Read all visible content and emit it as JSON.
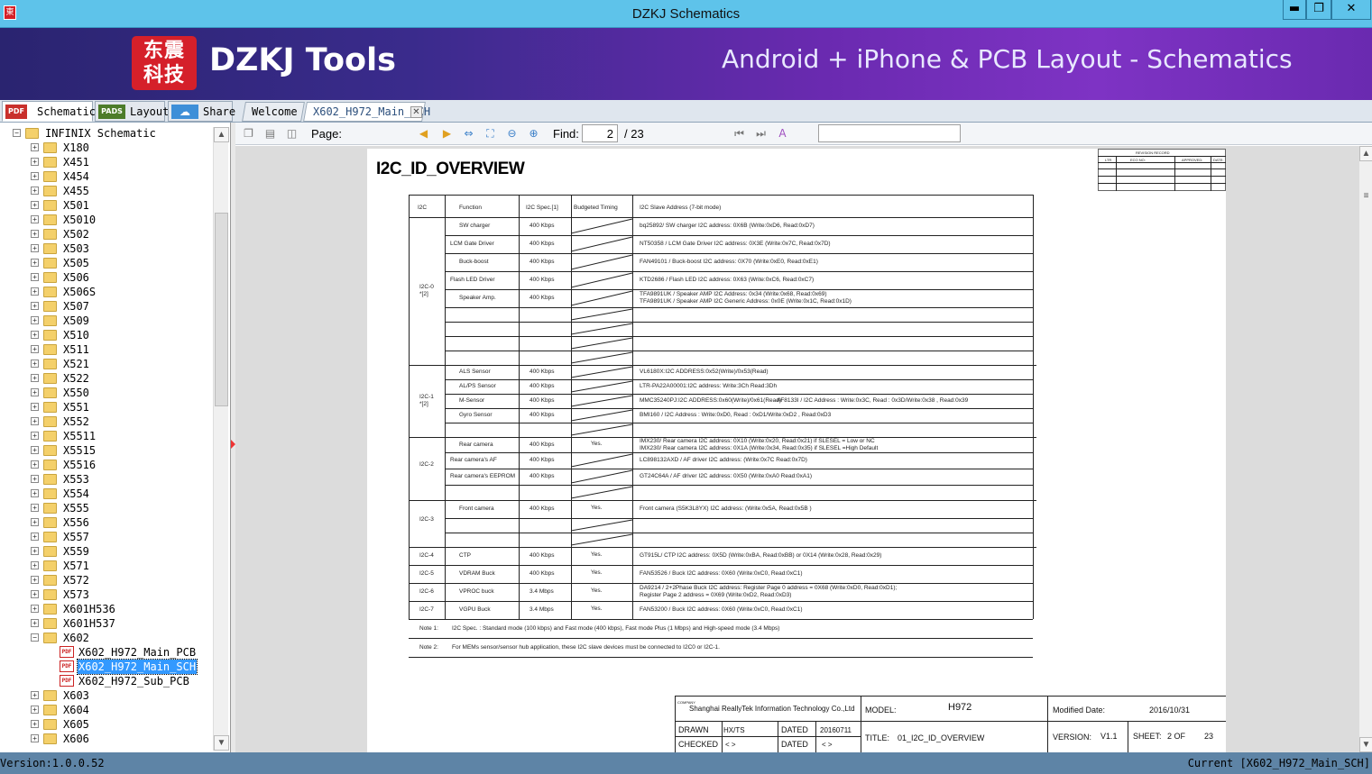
{
  "window": {
    "title": "DZKJ Schematics",
    "icon_label": "東",
    "min": "▬",
    "max": "❐",
    "close": "✕"
  },
  "banner": {
    "logo": "东震\n科技",
    "brand": "DZKJ Tools",
    "tagline": "Android + iPhone & PCB Layout - Schematics"
  },
  "left_tabs": [
    {
      "icon": "PDF",
      "label": "Schematic",
      "active": true,
      "color": "#c9302c"
    },
    {
      "icon": "PADS",
      "label": "Layout",
      "active": false,
      "color": "#4d7c2a"
    },
    {
      "icon": "☁",
      "label": "Share",
      "active": false,
      "color": "#3e8fd8"
    }
  ],
  "doc_tabs": [
    {
      "label": "Welcome",
      "active": false
    },
    {
      "label": "X602_H972_Main_SCH",
      "active": true
    }
  ],
  "tab_close": "✕",
  "tree": {
    "root": "INFINIX Schematic",
    "folders": [
      "X180",
      "X451",
      "X454",
      "X455",
      "X501",
      "X5010",
      "X502",
      "X503",
      "X505",
      "X506",
      "X506S",
      "X507",
      "X509",
      "X510",
      "X511",
      "X521",
      "X522",
      "X550",
      "X551",
      "X552",
      "X5511",
      "X5515",
      "X5516",
      "X553",
      "X554",
      "X555",
      "X556",
      "X557",
      "X559",
      "X571",
      "X572",
      "X573",
      "X601H536",
      "X601H537",
      "X602"
    ],
    "x602_children": [
      "X602_H972_Main_PCB",
      "X602_H972_Main_SCH",
      "X602_H972_Sub_PCB"
    ],
    "selected": "X602_H972_Main_SCH",
    "after": [
      "X603",
      "X604",
      "X605",
      "X606"
    ],
    "pdf_icon": "PDF"
  },
  "toolbar": {
    "page_label": "Page:",
    "page_value": "2",
    "page_total": "/ 23",
    "find_label": "Find:",
    "find_value": ""
  },
  "sheet": {
    "title": "I2C_ID_OVERVIEW",
    "revision_header": "REVISION RECORD",
    "revision_cols": [
      "LTR",
      "ECO NO:",
      "APPROVED:",
      "DATE:"
    ],
    "headers": [
      "I2C",
      "Function",
      "I2C Spec.[1]",
      "Budgeted Timing",
      "I2C Slave Address (7-bit mode)"
    ],
    "groups": [
      {
        "bus": "I2C-0\n*[2]",
        "rows": [
          {
            "fn": "SW charger",
            "spec": "400 Kbps",
            "timing": "",
            "addr": "bq25892/ SW charger I2C address: 0X6B (Write:0xD6, Read:0xD7)"
          },
          {
            "fn": "LCM Gate Driver",
            "spec": "400 Kbps",
            "timing": "",
            "addr": "NT50358 / LCM Gate Driver I2C address: 0X3E (Write:0x7C, Read:0x7D)"
          },
          {
            "fn": "Buck-boost",
            "spec": "400 Kbps",
            "timing": "",
            "addr": "FAN49101 / Buck-boost I2C address: 0X70 (Write:0xE0, Read:0xE1)"
          },
          {
            "fn": "Flash LED Driver",
            "spec": "400 Kbps",
            "timing": "",
            "addr": "KTD2686 / Flash LED I2C address: 0X63 (Write:0xC6, Read:0xC7)"
          },
          {
            "fn": "Speaker Amp.",
            "spec": "400 Kbps",
            "timing": "",
            "addr": "TFA9891UK / Speaker AMP I2C Address: 0x34 (Write:0x68, Read:0x69)\nTFA9891UK / Speaker AMP I2C Generic Address: 0x0E (Write:0x1C, Read:0x1D)"
          }
        ]
      },
      {
        "bus": "I2C-1\n*[2]",
        "rows": [
          {
            "fn": "ALS Sensor",
            "spec": "400 Kbps",
            "timing": "",
            "addr": "VL6180X:I2C ADDRESS:0x52(Write)/0x53(Read)"
          },
          {
            "fn": "AL/PS Sensor",
            "spec": "400 Kbps",
            "timing": "",
            "addr": "LTR-PA22A00001:I2C address: Write:3Ch Read:3Dh"
          },
          {
            "fn": "M-Sensor",
            "spec": "400 Kbps",
            "timing": "",
            "addr": "MMC35240PJ:I2C ADDRESS:0x60(Write)/0x61(Read)",
            "addr2": "AF8133I / I2C Address : Write:0x3C, Read : 0x3D/Write:0x38 , Read:0x39"
          },
          {
            "fn": "Gyro Sensor",
            "spec": "400 Kbps",
            "timing": "",
            "addr": "BMI160 / I2C Address : Write:0xD0, Read : 0xD1/Write:0xD2 , Read:0xD3"
          }
        ]
      },
      {
        "bus": "I2C-2",
        "rows": [
          {
            "fn": "Rear camera",
            "spec": "400 Kbps",
            "timing": "Yes.",
            "addr": "IMX230/ Rear camera I2C address: 0X10 (Write:0x20, Read:0x21) if SLESEL = Low or NC\nIMX230/ Rear camera I2C address: 0X1A (Write:0x34, Read:0x35) if SLESEL =High          Default"
          },
          {
            "fn": "Rear camera's AF",
            "spec": "400 Kbps",
            "timing": "",
            "addr": "LC898132AXD / AF driver I2C address:  (Write:0x7C  Read:0x7D)"
          },
          {
            "fn": "Rear camera's EEPROM",
            "spec": "400 Kbps",
            "timing": "",
            "addr": "GT24C64A / AF driver I2C address:  0X50 (Write:0xA0 Read:0xA1)"
          }
        ]
      },
      {
        "bus": "I2C-3",
        "rows": [
          {
            "fn": "Front camera",
            "spec": "400 Kbps",
            "timing": "Yes.",
            "addr": "Front camera (S5K3L8YX) I2C address:  (Write:0x5A, Read:0x5B )"
          }
        ]
      }
    ],
    "singles": [
      {
        "bus": "I2C-4",
        "fn": "CTP",
        "spec": "400 Kbps",
        "timing": "Yes.",
        "addr": "GT915L/ CTP I2C address: 0X5D (Write:0xBA, Read:0xBB) or 0X14 (Write:0x28, Read:0x29)"
      },
      {
        "bus": "I2C-5",
        "fn": "VDRAM Buck",
        "spec": "400 Kbps",
        "timing": "Yes.",
        "addr": "FAN53526 / Buck I2C address: 0X60 (Write:0xC0, Read:0xC1)"
      },
      {
        "bus": "I2C-6",
        "fn": "VPROC buck",
        "spec": "3.4 Mbps",
        "timing": "Yes.",
        "addr": "DA9214 / 2+2Phase Buck I2C address: Register Page 0 address = 0X68 (Write:0xD0, Read:0xD1);\nRegister Page 2 address = 0X69 (Write:0xD2, Read:0xD3)"
      },
      {
        "bus": "I2C-7",
        "fn": "VGPU Buck",
        "spec": "3.4 Mbps",
        "timing": "Yes.",
        "addr": "FAN53200 / Buck I2C address: 0X60 (Write:0xC0, Read:0xC1)"
      }
    ],
    "notes": [
      {
        "label": "Note 1:",
        "text": "I2C Spec. : Standard mode (100 kbps) and Fast mode (400 kbps), Fast mode Plus (1 Mbps) and High-speed mode (3.4 Mbps)"
      },
      {
        "label": "Note 2:",
        "text": "For MEMs sensor/sensor hub application, these I2C slave devices must be connected to I2C0 or I2C-1."
      }
    ],
    "title_block": {
      "company_label": "COMPANY",
      "company": "Shanghai ReallyTek Information Technology Co.,Ltd",
      "model_label": "MODEL:",
      "model": "H972",
      "modified_label": "Modified Date:",
      "modified": "2016/10/31",
      "drawn_label": "DRAWN",
      "drawn": "HX/TS",
      "dated_label": "DATED",
      "dated1": "20160711",
      "checked_label": "CHECKED",
      "checked": "< >",
      "dated2": "< >",
      "title_label": "TITLE:",
      "title": "01_I2C_ID_OVERVIEW",
      "version_label": "VERSION:",
      "version": "V1.1",
      "sheet_label": "SHEET:",
      "sheet": "2 OF",
      "sheet_total": "23"
    }
  },
  "status": {
    "left": "Version:1.0.0.52",
    "right": "Current [X602_H972_Main_SCH]"
  }
}
